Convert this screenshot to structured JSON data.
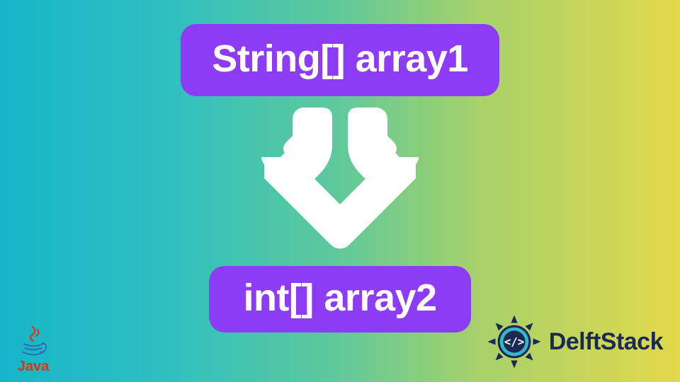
{
  "top_box": {
    "label": "String[] array1"
  },
  "bottom_box": {
    "label": "int[] array2"
  },
  "arrow": {
    "direction": "down",
    "icon": "download-arrow-icon"
  },
  "java_logo": {
    "name": "java-logo",
    "label": "Java"
  },
  "delft_logo": {
    "name": "delftstack-logo",
    "label": "DelftStack"
  },
  "colors": {
    "pill_bg": "#8c3cf5",
    "pill_text": "#ffffff",
    "arrow": "#ffffff",
    "java_red": "#e2330b",
    "delft_navy": "#1b2a55"
  }
}
